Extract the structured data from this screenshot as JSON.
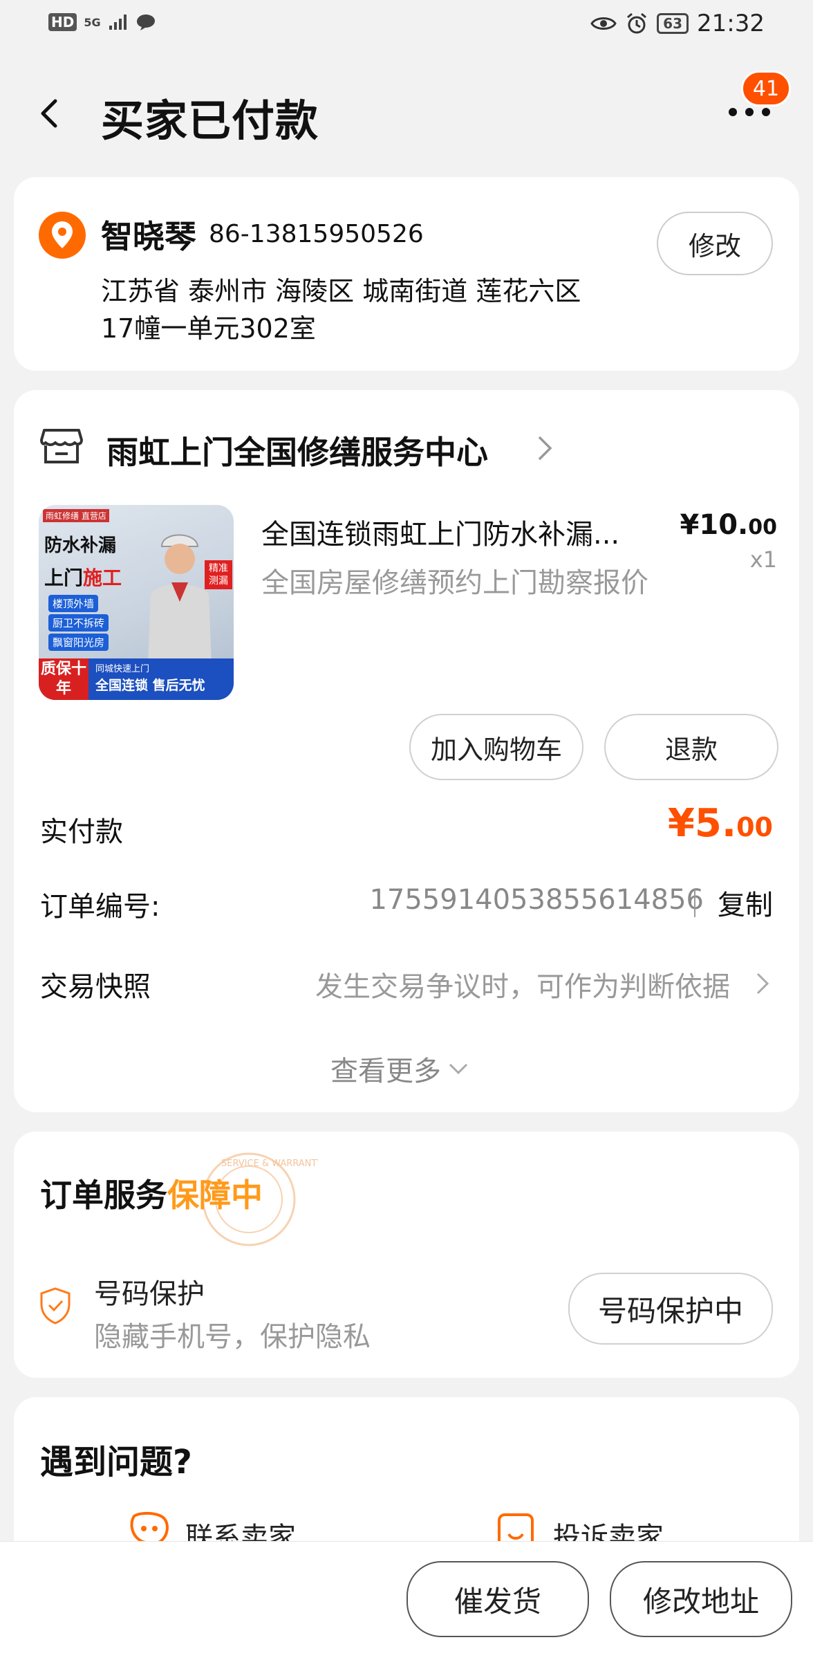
{
  "status_bar": {
    "hd": "HD",
    "net": "5G",
    "battery": "63",
    "time": "21:32"
  },
  "header": {
    "title": "买家已付款",
    "badge_count": "41"
  },
  "address": {
    "name": "智晓琴",
    "phone": "86-13815950526",
    "line1": "江苏省 泰州市 海陵区 城南街道 莲花六区",
    "line2": "17幢一单元302室",
    "edit_label": "修改"
  },
  "shop": {
    "name": "雨虹上门全国修缮服务中心"
  },
  "product": {
    "title": "全国连锁雨虹上门防水补漏...",
    "subtitle": "全国房屋修缮预约上门勘察报价",
    "price_main": "¥10.",
    "price_dec": "00",
    "qty": "x1",
    "image": {
      "top_label": "雨虹修缮 直营店",
      "headline1": "防水补漏",
      "headline2a": "上门",
      "headline2b": "施工",
      "tags": [
        "楼顶外墙",
        "厨卫不拆砖",
        "飘窗阳光房"
      ],
      "corner": "精准测漏",
      "quality": "质保十年",
      "chain_small": "同城快速上门",
      "chain": "全国连锁 售后无忧"
    },
    "add_cart_label": "加入购物车",
    "refund_label": "退款"
  },
  "payment": {
    "paid_label": "实付款",
    "paid_main": "¥5.",
    "paid_dec": "00",
    "order_no_label": "订单编号:",
    "order_no": "1755914053855614856",
    "copy_label": "复制",
    "snapshot_label": "交易快照",
    "snapshot_hint": "发生交易争议时，可作为判断依据",
    "view_more": "查看更多"
  },
  "service": {
    "title_prefix": "订单服务",
    "title_highlight": "保障中",
    "stamp_text": "SERVICE & WARRANTY",
    "number_protect_title": "号码保护",
    "number_protect_sub": "隐藏手机号，保护隐私",
    "number_protect_btn": "号码保护中"
  },
  "problem": {
    "title": "遇到问题?",
    "contact_label": "联系卖家",
    "complain_label": "投诉卖家"
  },
  "bottom_bar": {
    "urge_label": "催发货",
    "change_address_label": "修改地址"
  },
  "colors": {
    "accent": "#ff5000",
    "highlight": "#ff9a1a",
    "background": "#f2f2f2"
  }
}
